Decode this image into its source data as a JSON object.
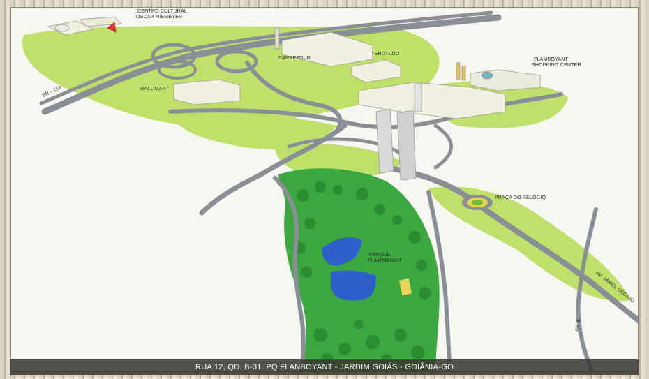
{
  "labels": {
    "centro_cultural": "CENTRO CULTURAL",
    "oscar_niemeyer": "OSCAR NIEMEYER",
    "carrefour": "CARREFOUR",
    "tendtudo": "TENDTUDO",
    "flamboyant_1": "FLAMBOYANT",
    "flamboyant_2": "SHOPPING CENTER",
    "wall_mart": "WALL MART",
    "br153": "BR - 153",
    "praca": "PRAÇA DO RELÓGIO",
    "parque_1": "PARQUE",
    "parque_2": "FLAMBOYANT",
    "av_jamel": "AV. JAMEL CECÍLIO",
    "av_e": "AV. E"
  },
  "caption": "RUA 12, QD. B-31. PQ FLANBOYANT - JARDIM GOIÁS - GOIÂNIA-GO",
  "colors": {
    "road": "#8a8f96",
    "road_edge": "#6d727a",
    "grass": "#a6d43c",
    "park": "#3aa83e",
    "lake": "#2f5fc9",
    "building": "#f2f0e0",
    "tower": "#d9dadb"
  }
}
